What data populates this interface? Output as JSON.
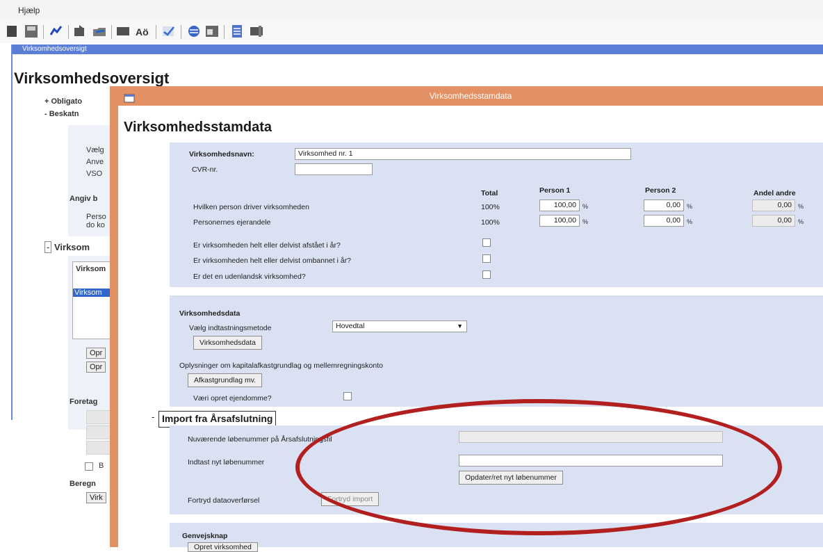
{
  "menubar": {
    "help": "Hjælp"
  },
  "outer": {
    "tab_label": "Virksomhedsoversigt",
    "title": "Virksomhedsoversigt",
    "tree": [
      {
        "sign": "+",
        "label": "Obligato"
      },
      {
        "sign": "-",
        "label": "Beskatn"
      }
    ],
    "side_labels": [
      "Vælg",
      "Anve",
      "VSO"
    ],
    "angiv_label": "Angiv b",
    "person_label_1": "Perso",
    "person_label_2": "do ko",
    "virksomhed_section": "Virksom",
    "virksomhed_box_header": "Virksom",
    "virksomhed_box_item": "Virksom",
    "buttons": [
      "Opr",
      "Opr"
    ],
    "foretag_label": "Foretag",
    "checkbox_label": "B",
    "beregn_label": "Beregn",
    "bottom_button": "Virk"
  },
  "dialog": {
    "title": "Virksomhedsstamdata",
    "heading": "Virksomhedsstamdata",
    "fields": {
      "virksomhedsnavn_label": "Virksomhedsnavn:",
      "virksomhedsnavn_value": "Virksomhed nr. 1",
      "cvr_label": "CVR-nr.",
      "cvr_value": ""
    },
    "table": {
      "headers": {
        "total": "Total",
        "person1": "Person 1",
        "person2": "Person 2",
        "andel": "Andel andre"
      },
      "rows": [
        {
          "label": "Hvilken person driver virksomheden",
          "total": "100%",
          "p1": "100,00",
          "p2": "0,00",
          "andel": "0,00"
        },
        {
          "label": "Personernes ejerandele",
          "total": "100%",
          "p1": "100,00",
          "p2": "0,00",
          "andel": "0,00"
        }
      ],
      "pct": "%"
    },
    "questions": [
      "Er virksomheden helt eller delvist afstået i år?",
      "Er virksomheden helt eller delvist ombannet i år?",
      "Er det en udenlandsk virksomhed?"
    ],
    "virksomhedsdata": {
      "title": "Virksomhedsdata",
      "select_label": "Vælg indtastningsmetode",
      "select_value": "Hovedtal",
      "button": "Virksomhedsdata"
    },
    "oplysninger": {
      "title": "Oplysninger om kapitalafkastgrundlag og mellemregningskonto",
      "button": "Afkastgrundlag mv.",
      "question": "Væri opret ejendomme?"
    },
    "import": {
      "section_sign": "-",
      "section_title": "Import fra Årsafslutning",
      "current_label": "Nuværende løbenummer på Årsafslutningsfil",
      "current_value": "",
      "new_label": "Indtast nyt løbenummer",
      "new_value": "",
      "update_button": "Opdater/ret nyt løbenummer",
      "transfer_label": "Fortryd dataoverførsel",
      "transfer_button": "Fortryd import"
    },
    "bottom": {
      "title": "Genvejsknap",
      "button": "Opret virksomhed"
    }
  },
  "colors": {
    "accent_tab": "#5b7fd6",
    "dialog_border": "#e49065",
    "panel_bg": "#d9e1f2",
    "annotation_ellipse": "#b21f1f"
  }
}
